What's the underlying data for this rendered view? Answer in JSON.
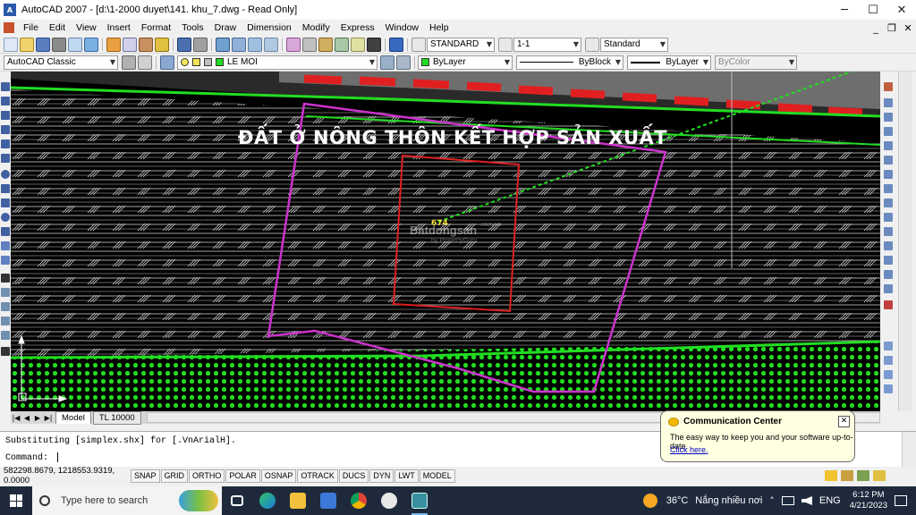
{
  "window": {
    "app_icon_text": "A",
    "title": "AutoCAD 2007 - [d:\\1-2000 duyet\\141. khu_7.dwg - Read Only]",
    "minimize": "─",
    "maximize": "☐",
    "close": "✕"
  },
  "menu": {
    "items": [
      "File",
      "Edit",
      "View",
      "Insert",
      "Format",
      "Tools",
      "Draw",
      "Dimension",
      "Modify",
      "Express",
      "Window",
      "Help"
    ],
    "doc_controls": [
      "_",
      "❐",
      "✕"
    ]
  },
  "toolbar1": {
    "text_style": "STANDARD",
    "dim_style": "1-1",
    "table_style": "Standard"
  },
  "toolbar2": {
    "workspace": "AutoCAD Classic",
    "layer": "LE MOI",
    "color": "ByLayer",
    "linetype": "ByBlock",
    "lineweight": "ByLayer",
    "plotstyle": "ByColor"
  },
  "drawing": {
    "label": "ĐẤT Ở NÔNG THÔN KẾT HỢP SẢN XUẤT",
    "parcel_number": "674",
    "watermark": "Batdongsan",
    "watermark_sub": "by PropertyGuru",
    "watermark_site": ".com.vn",
    "colors": {
      "background": "#000000",
      "hatch": "#d9d9d9",
      "parcel_outline": "#cc33cc",
      "lot_outline": "#e02020",
      "boundary_line": "#22dd22",
      "label_text": "#ffffff"
    }
  },
  "tabs": {
    "nav": [
      "|◀",
      "◀",
      "▶",
      "▶|"
    ],
    "items": [
      "Model",
      "TL 10000"
    ],
    "active": "Model"
  },
  "command": {
    "history": "Substituting [simplex.shx] for [.VnArialH].",
    "prompt": "Command:"
  },
  "status": {
    "coordinates": "582298.8679, 1218553.9319, 0.0000",
    "buttons": [
      "SNAP",
      "GRID",
      "ORTHO",
      "POLAR",
      "OSNAP",
      "OTRACK",
      "DUCS",
      "DYN",
      "LWT",
      "MODEL"
    ]
  },
  "communication_center": {
    "title": "Communication Center",
    "body": "The easy way to keep you and your software up-to-date.",
    "link": "Click here.",
    "close": "✕"
  },
  "taskbar": {
    "search_placeholder": "Type here to search",
    "weather_temp": "36°C",
    "weather_desc": "Nắng nhiều nơi",
    "language": "ENG",
    "time": "6:12 PM",
    "date": "4/21/2023"
  }
}
